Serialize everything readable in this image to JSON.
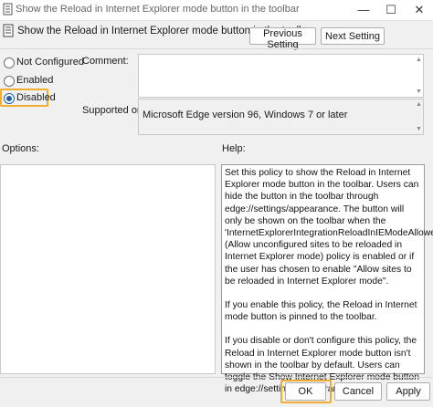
{
  "window": {
    "title": "Show the Reload in Internet Explorer mode button in the toolbar"
  },
  "header": {
    "title": "Show the Reload in Internet Explorer mode button in the toolbar",
    "previous_label": "Previous Setting",
    "next_label": "Next Setting"
  },
  "state": {
    "options": [
      {
        "label": "Not Configured",
        "selected": false
      },
      {
        "label": "Enabled",
        "selected": false
      },
      {
        "label": "Disabled",
        "selected": true
      }
    ]
  },
  "comment": {
    "label": "Comment:",
    "value": ""
  },
  "supported": {
    "label": "Supported on:",
    "value": "Microsoft Edge version 96, Windows 7 or later"
  },
  "options_panel": {
    "label": "Options:"
  },
  "help_panel": {
    "label": "Help:",
    "paragraphs": [
      "Set this policy to show the Reload in Internet Explorer mode button in the toolbar. Users can hide the button in the toolbar through edge://settings/appearance.  The button will only be shown on the toolbar when the 'InternetExplorerIntegrationReloadInIEModeAllowed' (Allow unconfigured sites to be reloaded in Internet Explorer mode) policy is enabled or if the user has chosen to enable \"Allow sites to be reloaded in Internet Explorer mode\".",
      "If you enable this policy, the Reload in Internet mode button is pinned to the toolbar.",
      "If you disable or don't configure this policy, the Reload in Internet Explorer mode button isn't shown in the toolbar by default. Users can toggle the Show Internet Explorer mode button in edge://settings/appearance."
    ]
  },
  "footer": {
    "ok_label": "OK",
    "cancel_label": "Cancel",
    "apply_label": "Apply"
  },
  "colors": {
    "highlight": "#f0ad32",
    "radio_selected": "#1f5fa8"
  }
}
